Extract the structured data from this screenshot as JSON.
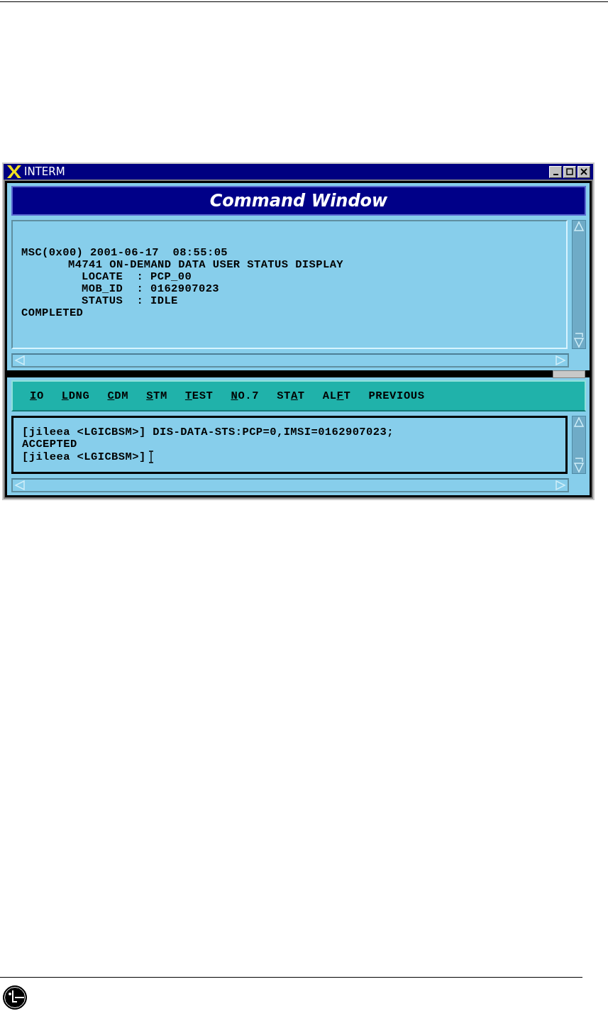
{
  "window": {
    "title": "INTERM"
  },
  "header": {
    "title": "Command Window"
  },
  "output": {
    "lines": [
      {
        "kind": "heading",
        "text": "MSC(0x00) 2001-06-17  08:55:05"
      },
      {
        "kind": "subheading",
        "text": "M4741 ON-DEMAND DATA USER STATUS DISPLAY"
      },
      {
        "kind": "field",
        "text": "LOCATE  : PCP_00"
      },
      {
        "kind": "field",
        "text": "MOB_ID  : 0162907023"
      },
      {
        "kind": "field",
        "text": "STATUS  : IDLE"
      },
      {
        "kind": "heading",
        "text": "COMPLETED"
      }
    ]
  },
  "menu": [
    {
      "key": "I",
      "post": "O"
    },
    {
      "key": "L",
      "post": "DNG"
    },
    {
      "key": "C",
      "post": "DM"
    },
    {
      "key": "S",
      "post": "TM"
    },
    {
      "key": "T",
      "post": "EST"
    },
    {
      "key": "N",
      "post": "O.7"
    },
    {
      "pre": "ST",
      "key": "A",
      "post": "T"
    },
    {
      "pre": "AL",
      "key": "F",
      "post": "T"
    },
    {
      "pre": "PREVIOUS"
    }
  ],
  "input": {
    "lines": [
      "[jileea <LGICBSM>] DIS-DATA-STS:PCP=0,IMSI=0162907023;",
      "ACCEPTED"
    ],
    "prompt": "[jileea <LGICBSM>]"
  }
}
